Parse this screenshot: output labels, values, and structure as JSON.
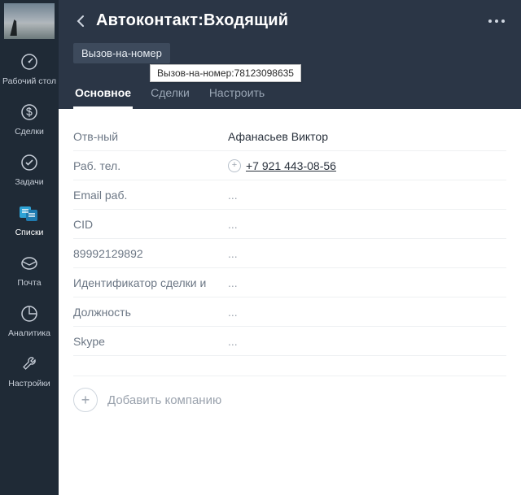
{
  "sidebar": {
    "items": [
      {
        "label": "Рабочий стол"
      },
      {
        "label": "Сделки"
      },
      {
        "label": "Задачи"
      },
      {
        "label": "Списки"
      },
      {
        "label": "Почта"
      },
      {
        "label": "Аналитика"
      },
      {
        "label": "Настройки"
      }
    ],
    "active_index": 3
  },
  "header": {
    "title": "Автоконтакт:Входящий",
    "tag": "Вызов-на-номер",
    "tooltip": "Вызов-на-номер:78123098635"
  },
  "tabs": [
    {
      "label": "Основное",
      "active": true
    },
    {
      "label": "Сделки",
      "active": false
    },
    {
      "label": "Настроить",
      "active": false
    }
  ],
  "fields": [
    {
      "label": "Отв-ный",
      "value": "Афанасьев Виктор",
      "type": "text"
    },
    {
      "label": "Раб. тел.",
      "value": "+7 921 443-08-56",
      "type": "phone"
    },
    {
      "label": "Email раб.",
      "value": "...",
      "type": "empty"
    },
    {
      "label": "CID",
      "value": "...",
      "type": "empty"
    },
    {
      "label": "89992129892",
      "value": "...",
      "type": "empty"
    },
    {
      "label": "Идентификатор сделки и",
      "value": "...",
      "type": "empty"
    },
    {
      "label": "Должность",
      "value": "...",
      "type": "empty"
    },
    {
      "label": "Skype",
      "value": "...",
      "type": "empty"
    }
  ],
  "add_company": {
    "label": "Добавить компанию"
  }
}
